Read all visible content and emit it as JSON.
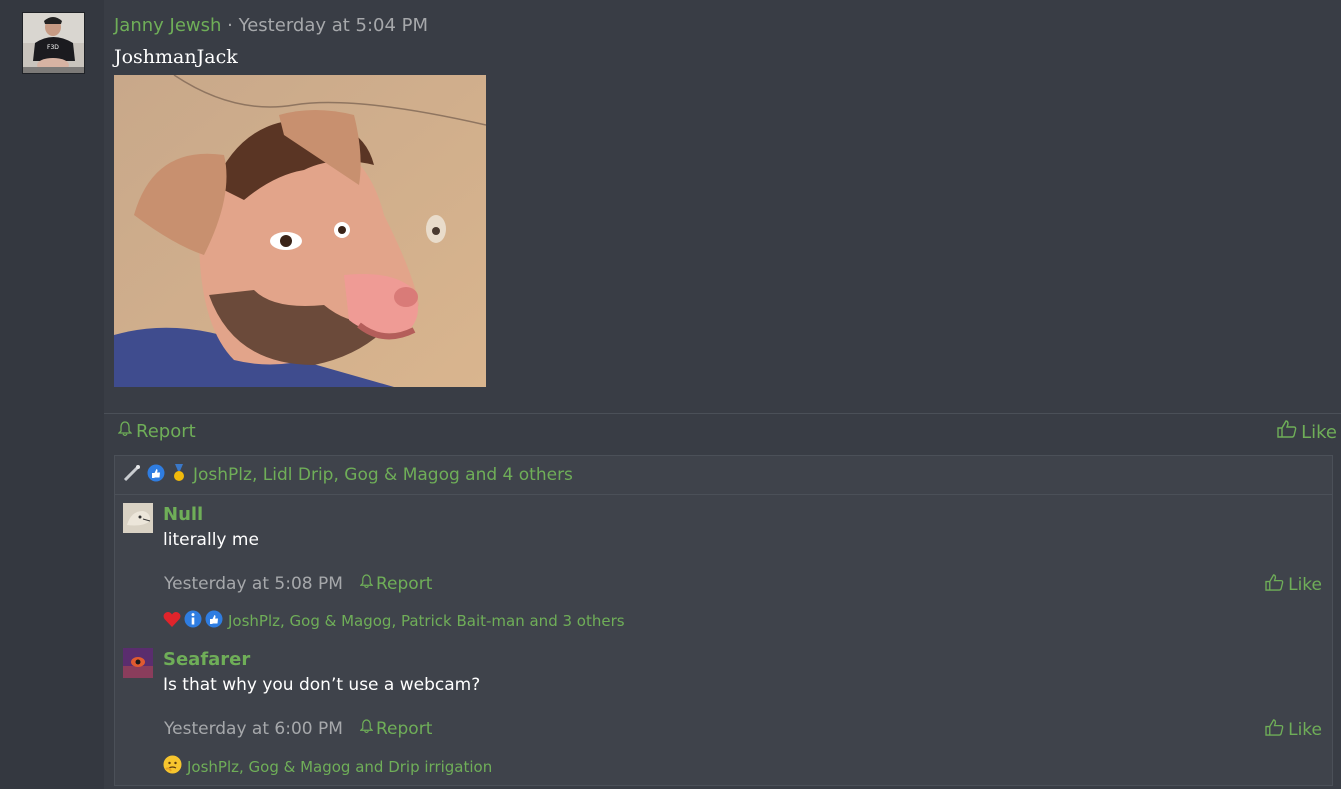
{
  "post": {
    "author": "Janny Jewsh",
    "separator": "·",
    "timestamp": "Yesterday at 5:04 PM",
    "title": "JoshmanJack",
    "report_label": "Report",
    "like_label": "Like",
    "reactions_text": "JoshPlz, Lidl Drip, Gog & Magog and 4 others"
  },
  "replies": [
    {
      "name": "Null",
      "text": "literally me",
      "timestamp": "Yesterday at 5:08 PM",
      "report_label": "Report",
      "like_label": "Like",
      "reactions_text": "JoshPlz, Gog & Magog, Patrick Bait-man and 3 others"
    },
    {
      "name": "Seafarer",
      "text": "Is that why you don’t use a webcam?",
      "timestamp": "Yesterday at 6:00 PM",
      "report_label": "Report",
      "like_label": "Like",
      "reactions_text": "JoshPlz, Gog & Magog and Drip irrigation"
    }
  ],
  "colors": {
    "accent": "#6fae58",
    "background": "#393d45",
    "muted": "#a6a8ab"
  }
}
